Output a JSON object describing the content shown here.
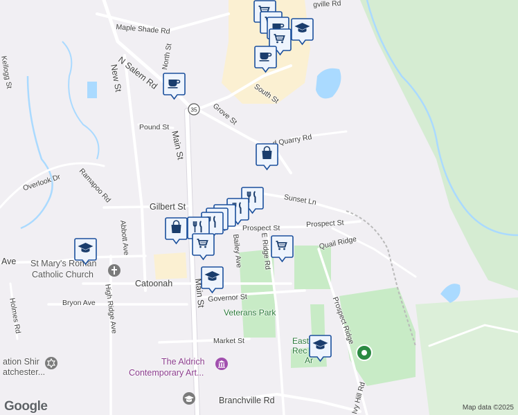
{
  "roads": [
    {
      "id": "maple-shade-rd",
      "label": "Maple Shade Rd"
    },
    {
      "id": "n-salem-rd",
      "label": "N Salem Rd"
    },
    {
      "id": "north-st",
      "label": "North St"
    },
    {
      "id": "new-st",
      "label": "New St"
    },
    {
      "id": "kellogg-st",
      "label": "Kellogg St"
    },
    {
      "id": "grove-st",
      "label": "Grove St"
    },
    {
      "id": "south-st",
      "label": "South St"
    },
    {
      "id": "pound-st",
      "label": "Pound St"
    },
    {
      "id": "main-st-north",
      "label": "Main St"
    },
    {
      "id": "quarry-rd",
      "label": "d Quarry Rd"
    },
    {
      "id": "overlook-dr",
      "label": "Overlook Dr"
    },
    {
      "id": "ramapoo-rd",
      "label": "Ramapoo Rd"
    },
    {
      "id": "gilbert-st",
      "label": "Gilbert St"
    },
    {
      "id": "sunset-ln",
      "label": "Sunset Ln"
    },
    {
      "id": "abbott-ave",
      "label": "Abbott Ave"
    },
    {
      "id": "prospect-st-west",
      "label": "Prospect St"
    },
    {
      "id": "prospect-st-east",
      "label": "Prospect St"
    },
    {
      "id": "e-ridge-rd",
      "label": "E Ridge Rd"
    },
    {
      "id": "bailey-ave",
      "label": "Bailey Ave"
    },
    {
      "id": "quail-ridge",
      "label": "Quail Ridge"
    },
    {
      "id": "ave-west",
      "label": "Ave"
    },
    {
      "id": "catoonah",
      "label": "Catoonah"
    },
    {
      "id": "main-st-south",
      "label": "Main St"
    },
    {
      "id": "high-ridge-ave",
      "label": "High Ridge Ave"
    },
    {
      "id": "bryon-ave",
      "label": "Bryon Ave"
    },
    {
      "id": "governor-st",
      "label": "Governor St"
    },
    {
      "id": "prospect-ridge",
      "label": "Prospect Ridge"
    },
    {
      "id": "holmes-rd",
      "label": "Holmes Rd"
    },
    {
      "id": "market-st",
      "label": "Market St"
    },
    {
      "id": "ivy-hill-rd",
      "label": "Ivy Hill Rd"
    },
    {
      "id": "branchville-rd",
      "label": "Branchville Rd"
    },
    {
      "id": "ville-rd",
      "label": "gville Rd"
    }
  ],
  "route_shield": "35",
  "places": {
    "veterans_park": "Veterans Park",
    "east_rec_line1": "East",
    "east_rec_line2": "Rec",
    "east_rec_line3": "Ar",
    "aldrich_line1": "The Aldrich",
    "aldrich_line2": "Contemporary Art...",
    "st_marys_line1": "St Mary's Roman",
    "st_marys_line2": "Catholic Church",
    "ation_line1": "ation Shir",
    "ation_line2": "atchester..."
  },
  "markers": [
    {
      "type": "grocery-icon"
    },
    {
      "type": "grocery-icon"
    },
    {
      "type": "cafe-icon"
    },
    {
      "type": "school-icon"
    },
    {
      "type": "grocery-icon"
    },
    {
      "type": "cafe-icon"
    },
    {
      "type": "cafe-icon"
    },
    {
      "type": "shopping-bag-icon"
    },
    {
      "type": "restaurant-icon"
    },
    {
      "type": "restaurant-icon"
    },
    {
      "type": "restaurant-icon"
    },
    {
      "type": "restaurant-icon"
    },
    {
      "type": "restaurant-icon"
    },
    {
      "type": "restaurant-icon"
    },
    {
      "type": "shopping-bag-icon"
    },
    {
      "type": "grocery-icon"
    },
    {
      "type": "grocery-icon"
    },
    {
      "type": "school-icon"
    },
    {
      "type": "school-icon"
    },
    {
      "type": "school-icon"
    }
  ],
  "attribution": "Map data ©2025",
  "logo": "Google",
  "colors": {
    "water": "#aadaff",
    "park": "#c8ebc6",
    "forest": "#d5ecd2",
    "commercial": "#fbf0d2",
    "marker_border": "#1a4f9c",
    "marker_fill": "#eef4fd",
    "icon": "#1a3d6d"
  }
}
